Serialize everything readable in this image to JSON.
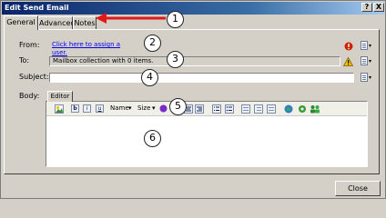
{
  "window": {
    "title": "Edit Send Email"
  },
  "titlebar_buttons": {
    "help": "?",
    "close": "X"
  },
  "tabs": [
    {
      "label": "General"
    },
    {
      "label": "Advanced"
    },
    {
      "label": "Notes"
    }
  ],
  "form": {
    "from_label": "From:",
    "from_value": "Click here to assign a user.",
    "to_label": "To:",
    "to_value": "Mailbox collection with 0 items.",
    "subject_label": "Subject:",
    "subject_value": "",
    "body_label": "Body:"
  },
  "editor": {
    "tab_label": "Editor",
    "toolbar": {
      "bold": "b",
      "italic": "i",
      "underline": "u",
      "font_name": "Name",
      "font_size": "Size"
    },
    "content": ""
  },
  "callouts": [
    "1",
    "2",
    "3",
    "4",
    "5",
    "6"
  ],
  "footer": {
    "close_label": "Close"
  },
  "colors": {
    "annotation_arrow": "#e01818",
    "error_icon": "#cc2200",
    "warning_icon": "#f2c200",
    "link": "#0000ee"
  },
  "icons": {
    "error": "error-icon",
    "warning": "warning-icon",
    "expression": "document-icon"
  }
}
